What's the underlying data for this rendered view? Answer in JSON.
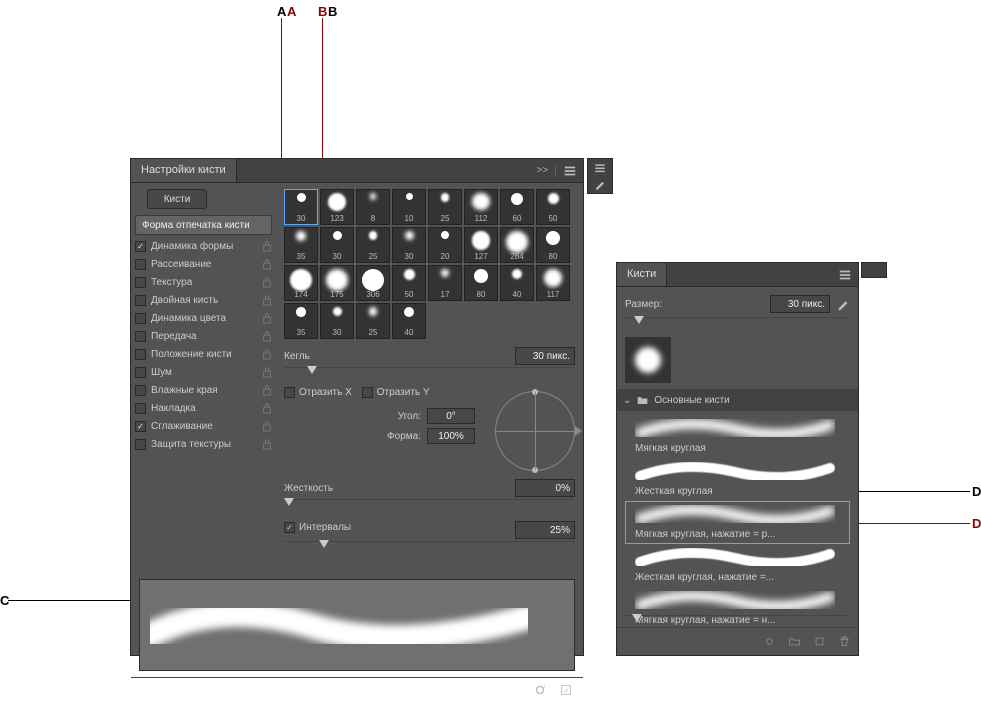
{
  "callouts": {
    "a": "A",
    "b": "B",
    "c": "C",
    "d": "D"
  },
  "left_panel": {
    "title": "Настройки кисти",
    "collapse": ">>",
    "kisti_btn": "Кисти",
    "forma_btn": "Форма отпечатка кисти",
    "options": [
      {
        "label": "Динамика формы",
        "checked": true
      },
      {
        "label": "Рассеивание",
        "checked": false
      },
      {
        "label": "Текстура",
        "checked": false
      },
      {
        "label": "Двойная кисть",
        "checked": false
      },
      {
        "label": "Динамика цвета",
        "checked": false
      },
      {
        "label": "Передача",
        "checked": false
      },
      {
        "label": "Положение кисти",
        "checked": false
      },
      {
        "label": "Шум",
        "checked": false
      },
      {
        "label": "Влажные края",
        "checked": false
      },
      {
        "label": "Накладка",
        "checked": false
      },
      {
        "label": "Сглаживание",
        "checked": true
      },
      {
        "label": "Защита текстуры",
        "checked": false
      }
    ],
    "thumbs": [
      "30",
      "123",
      "8",
      "10",
      "25",
      "112",
      "60",
      "50",
      "35",
      "30",
      "25",
      "30",
      "20",
      "127",
      "284",
      "80",
      "174",
      "175",
      "306",
      "50",
      "17",
      "80",
      "40",
      "117",
      "35",
      "30",
      "25",
      "40"
    ],
    "size_label": "Кегль",
    "size_value": "30 пикс.",
    "flip_x": "Отразить X",
    "flip_y": "Отразить Y",
    "angle_label": "Угол:",
    "angle_value": "0°",
    "shape_label": "Форма:",
    "shape_value": "100%",
    "hardness_label": "Жесткость",
    "hardness_value": "0%",
    "spacing_label": "Интервалы",
    "spacing_value": "25%"
  },
  "right_panel": {
    "title": "Кисти",
    "size_label": "Размер:",
    "size_value": "30 пикс.",
    "folder_label": "Основные кисти",
    "brushes": [
      "Мягкая круглая",
      "Жесткая круглая",
      "Мягкая круглая, нажатие = р...",
      "Жесткая круглая, нажатие =...",
      "Мягкая круглая, нажатие = н..."
    ],
    "selected_index": 2
  }
}
